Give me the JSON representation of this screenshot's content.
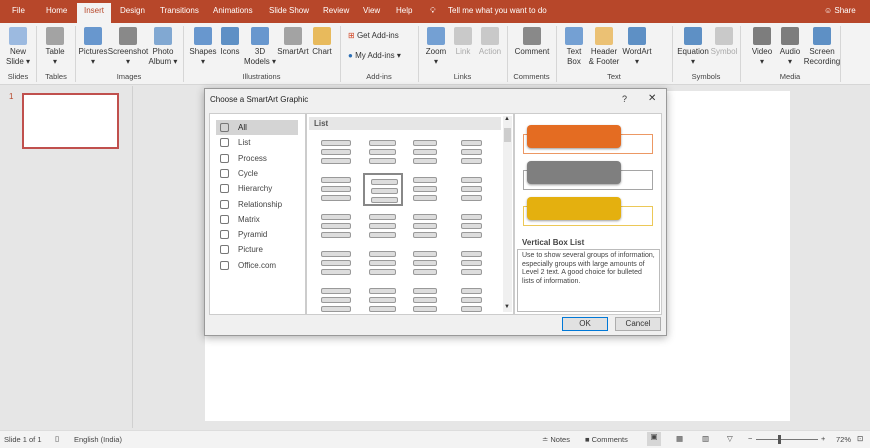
{
  "tabs": [
    "File",
    "Home",
    "Insert",
    "Design",
    "Transitions",
    "Animations",
    "Slide Show",
    "Review",
    "View",
    "Help"
  ],
  "tell_me": "Tell me what you want to do",
  "share": "Share",
  "ribbon": {
    "buttons": [
      {
        "label": "New",
        "label2": "Slide ▾",
        "icon": "new-slide-icon"
      },
      {
        "label": "Table",
        "label2": "▾",
        "icon": "table-icon"
      },
      {
        "label": "Pictures",
        "label2": "▾",
        "icon": "pictures-icon"
      },
      {
        "label": "Screenshot",
        "label2": "▾",
        "icon": "screenshot-icon"
      },
      {
        "label": "Photo",
        "label2": "Album ▾",
        "icon": "photo-album-icon"
      },
      {
        "label": "Shapes",
        "label2": "▾",
        "icon": "shapes-icon"
      },
      {
        "label": "Icons",
        "label2": "",
        "icon": "icons-icon"
      },
      {
        "label": "3D",
        "label2": "Models ▾",
        "icon": "3d-models-icon"
      },
      {
        "label": "SmartArt",
        "label2": "",
        "icon": "smartart-icon"
      },
      {
        "label": "Chart",
        "label2": "",
        "icon": "chart-icon"
      },
      {
        "label": "Zoom",
        "label2": "▾",
        "icon": "zoom-icon"
      },
      {
        "label": "Link",
        "label2": "",
        "icon": "link-icon"
      },
      {
        "label": "Action",
        "label2": "",
        "icon": "action-icon"
      },
      {
        "label": "Comment",
        "label2": "",
        "icon": "comment-icon"
      },
      {
        "label": "Text",
        "label2": "Box",
        "icon": "text-box-icon"
      },
      {
        "label": "Header",
        "label2": "& Footer",
        "icon": "header-footer-icon"
      },
      {
        "label": "WordArt",
        "label2": "▾",
        "icon": "wordart-icon"
      },
      {
        "label": "Equation",
        "label2": "▾",
        "icon": "equation-icon"
      },
      {
        "label": "Symbol",
        "label2": "",
        "icon": "symbol-icon"
      },
      {
        "label": "Video",
        "label2": "▾",
        "icon": "video-icon"
      },
      {
        "label": "Audio",
        "label2": "▾",
        "icon": "audio-icon"
      },
      {
        "label": "Screen",
        "label2": "Recording",
        "icon": "screen-recording-icon"
      }
    ],
    "get_addins": "Get Add-ins",
    "my_addins": "My Add-ins",
    "groups": [
      "Slides",
      "Tables",
      "Images",
      "Illustrations",
      "Add-ins",
      "Links",
      "Comments",
      "Text",
      "Symbols",
      "Media"
    ]
  },
  "thumbnail": {
    "number": "1"
  },
  "dialog": {
    "title": "Choose a SmartArt Graphic",
    "help": "?",
    "close": "✕",
    "categories": [
      "All",
      "List",
      "Process",
      "Cycle",
      "Hierarchy",
      "Relationship",
      "Matrix",
      "Pyramid",
      "Picture",
      "Office.com"
    ],
    "selected_category": "All",
    "gallery_header": "List",
    "preview_title": "Vertical Box List",
    "preview_description": "Use to show several groups of information, especially groups with large amounts of Level 2 text. A good choice for bulleted lists of information.",
    "preview_colors": [
      "#e46c22",
      "#7f7f7f",
      "#e4b00f"
    ],
    "ok": "OK",
    "cancel": "Cancel"
  },
  "status": {
    "slide": "Slide 1 of 1",
    "language": "English (India)",
    "notes": "Notes",
    "comments": "Comments",
    "zoom": "72%",
    "zoom_percent": 72
  },
  "colors": {
    "accent": "#b7472a"
  }
}
